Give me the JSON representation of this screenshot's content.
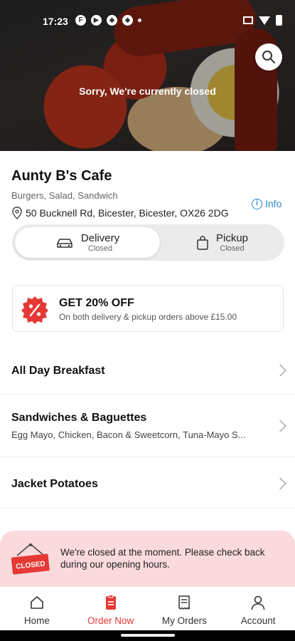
{
  "status_bar": {
    "time": "17:23"
  },
  "hero": {
    "closed_message": "Sorry, We're currently closed"
  },
  "cafe": {
    "name": "Aunty B's Cafe",
    "tags": "Burgers, Salad, Sandwich",
    "address": "50 Bucknell Rd, Bicester, Bicester, OX26 2DG",
    "info_label": "Info"
  },
  "order_mode": {
    "options": [
      {
        "label": "Delivery",
        "status": "Closed",
        "selected": true
      },
      {
        "label": "Pickup",
        "status": "Closed",
        "selected": false
      }
    ]
  },
  "promo": {
    "title": "GET 20% OFF",
    "subtitle": "On both delivery & pickup orders above £15.00",
    "badge_color": "#e53935"
  },
  "menu": [
    {
      "title": "All Day Breakfast",
      "subtitle": ""
    },
    {
      "title": "Sandwiches & Baguettes",
      "subtitle": "Egg Mayo, Chicken, Bacon & Sweetcorn, Tuna-Mayo S..."
    },
    {
      "title": "Jacket Potatoes",
      "subtitle": ""
    }
  ],
  "closed_banner": {
    "sign_text": "CLOSED",
    "message": "We're closed at the moment. Please check back during our opening hours."
  },
  "nav": {
    "items": [
      {
        "label": "Home",
        "icon": "home-icon"
      },
      {
        "label": "Order Now",
        "icon": "order-icon",
        "active": true
      },
      {
        "label": "My Orders",
        "icon": "receipt-icon"
      },
      {
        "label": "Account",
        "icon": "user-icon"
      }
    ]
  },
  "colors": {
    "accent": "#e53935",
    "link": "#2d88c8",
    "banner_bg": "#fadadd"
  }
}
